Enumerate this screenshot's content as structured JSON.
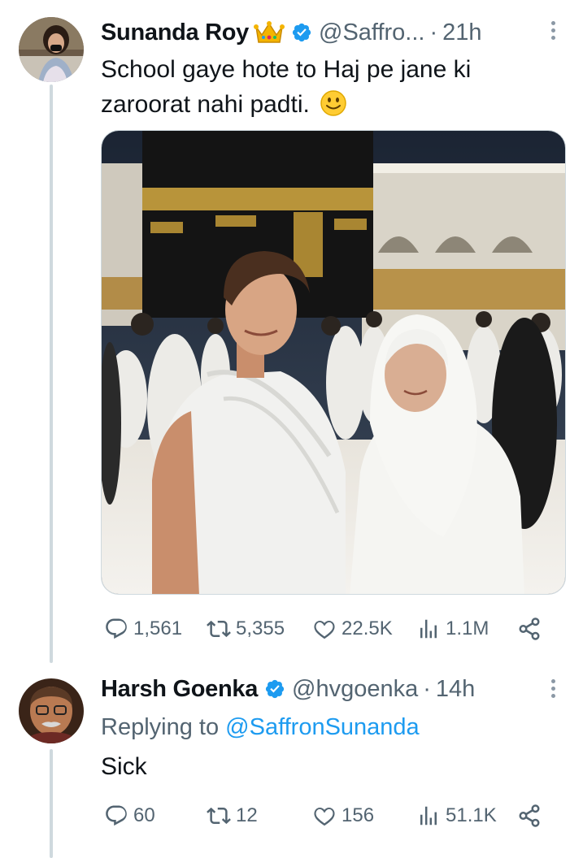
{
  "tweet1": {
    "display_name": "Sunanda Roy",
    "handle": "@Saffro...",
    "separator": "·",
    "time": "21h",
    "text": "School gaye hote to Haj pe jane ki zaroorat nahi padti.",
    "stats": {
      "replies": "1,561",
      "retweets": "5,355",
      "likes": "22.5K",
      "views": "1.1M"
    }
  },
  "tweet2": {
    "display_name": "Harsh Goenka",
    "handle": "@hvgoenka",
    "separator": "·",
    "time": "14h",
    "replying_prefix": "Replying to",
    "replying_mention": "@SaffronSunanda",
    "text": "Sick",
    "stats": {
      "replies": "60",
      "retweets": "12",
      "likes": "156",
      "views": "51.1K"
    }
  },
  "colors": {
    "verified": "#1d9bf0",
    "link": "#1d9bf0",
    "secondary_text": "#536471",
    "thread_line": "#cfd9de"
  },
  "icons": [
    "crown-emoji-icon",
    "verified-badge-icon",
    "smiley-emoji-icon",
    "more-icon",
    "reply-icon",
    "retweet-icon",
    "like-icon",
    "views-icon",
    "share-icon"
  ]
}
